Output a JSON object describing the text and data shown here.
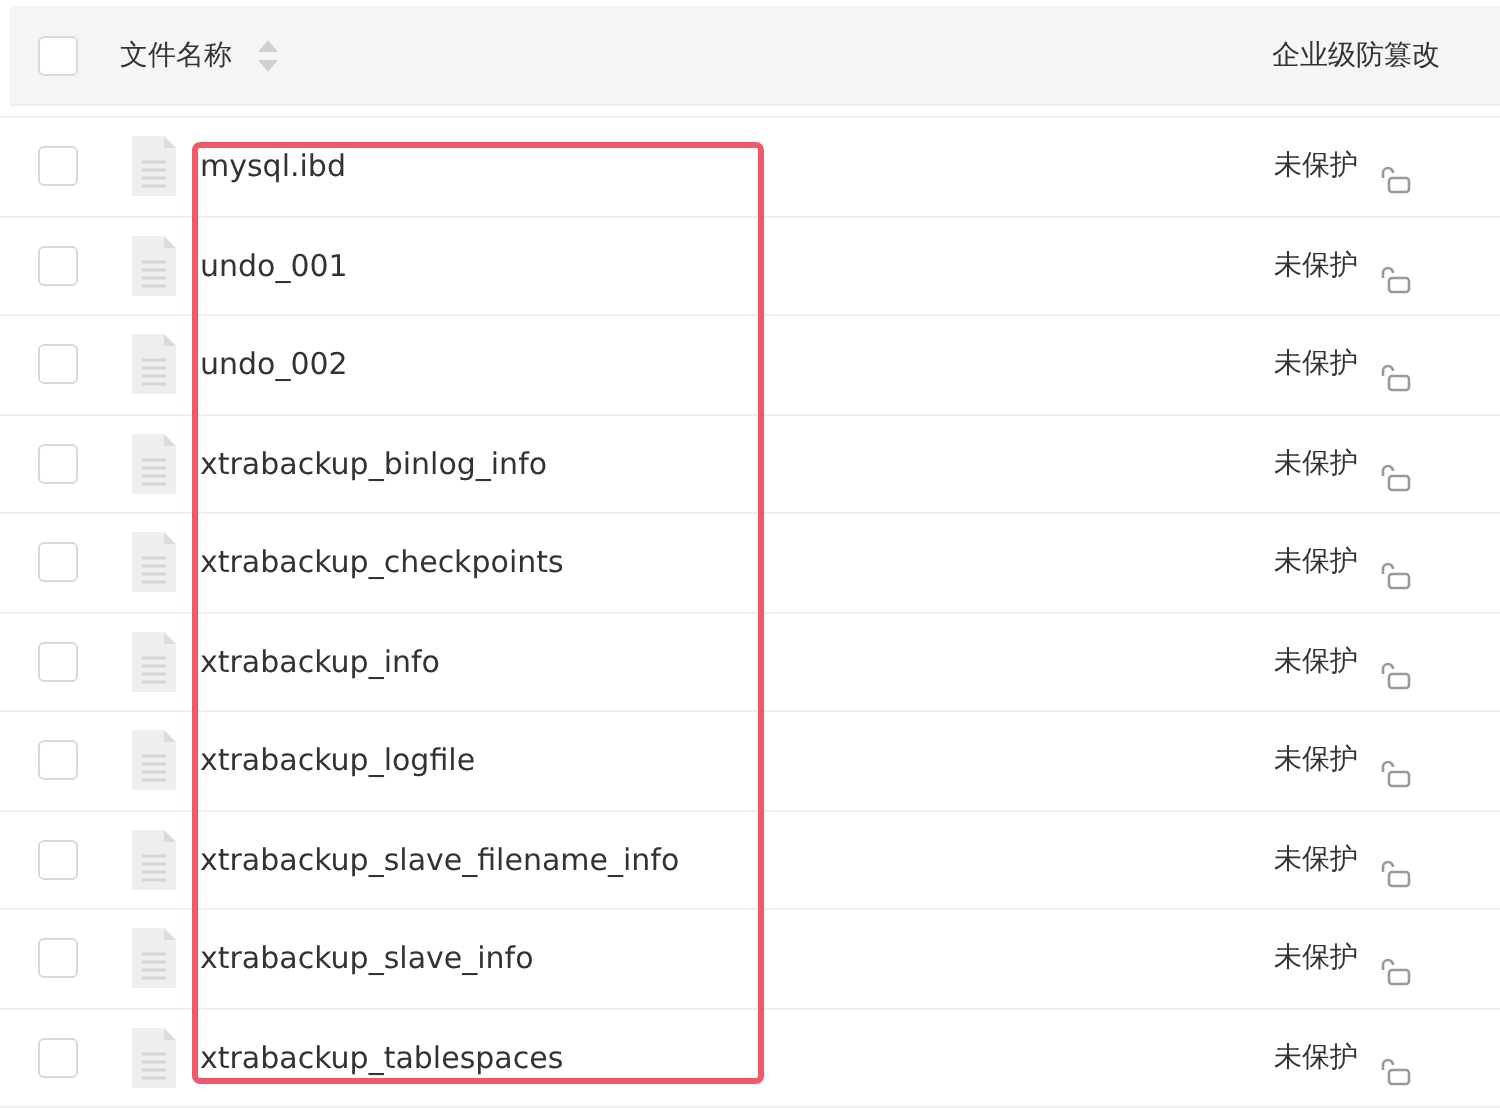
{
  "table": {
    "columns": [
      {
        "label": "文件名称",
        "sortable": true
      },
      {
        "label": "企业级防篡改"
      }
    ],
    "header_checkbox": {
      "checked": false
    },
    "rows": [
      {
        "name": "mysql.ibd",
        "status": "未保护",
        "checked": false
      },
      {
        "name": "undo_001",
        "status": "未保护",
        "checked": false
      },
      {
        "name": "undo_002",
        "status": "未保护",
        "checked": false
      },
      {
        "name": "xtrabackup_binlog_info",
        "status": "未保护",
        "checked": false
      },
      {
        "name": "xtrabackup_checkpoints",
        "status": "未保护",
        "checked": false
      },
      {
        "name": "xtrabackup_info",
        "status": "未保护",
        "checked": false
      },
      {
        "name": "xtrabackup_logfile",
        "status": "未保护",
        "checked": false
      },
      {
        "name": "xtrabackup_slave_filename_info",
        "status": "未保护",
        "checked": false
      },
      {
        "name": "xtrabackup_slave_info",
        "status": "未保护",
        "checked": false
      },
      {
        "name": "xtrabackup_tablespaces",
        "status": "未保护",
        "checked": false
      }
    ]
  },
  "highlight": {
    "shown": true
  }
}
